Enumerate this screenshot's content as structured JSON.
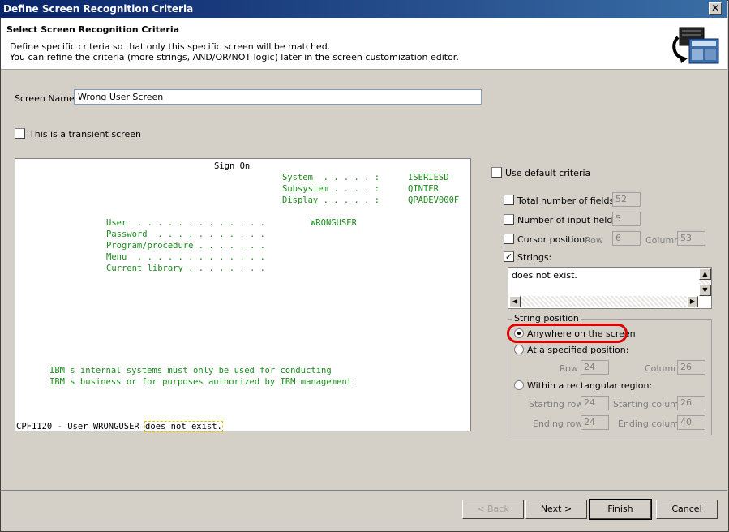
{
  "window": {
    "title": "Define Screen Recognition Criteria",
    "close": "✕"
  },
  "banner": {
    "title": "Select Screen Recognition Criteria",
    "line1": "Define specific criteria so that only this specific screen will be matched.",
    "line2": "You can refine the criteria (more strings, AND/OR/NOT logic) later in the screen customization editor."
  },
  "form": {
    "screen_name_label": "Screen Name:",
    "screen_name_value": "Wrong User Screen",
    "transient_label": "This is a transient screen"
  },
  "terminal": {
    "title": "Sign On",
    "system_label": "System  . . . . . :",
    "system_value": "ISERIESD",
    "subsystem_label": "Subsystem . . . . :",
    "subsystem_value": "QINTER",
    "display_label": "Display . . . . . :",
    "display_value": "QPADEV000F",
    "user_label": "User  . . . . . . . . . . . . .",
    "user_value": "WRONGUSER",
    "password_label": "Password  . . . . . . . . . . .",
    "program_label": "Program/procedure . . . . . . .",
    "menu_label": "Menu  . . . . . . . . . . . . .",
    "library_label": "Current library . . . . . . . .",
    "notice1": "IBM s internal systems must only be used for conducting",
    "notice2": "IBM s business or for purposes authorized by IBM management",
    "message_prefix": "CPF1120 - User WRONGUSER ",
    "message_highlight": "does not exist."
  },
  "criteria": {
    "use_default": "Use default criteria",
    "total_fields_label": "Total number of fields:",
    "total_fields_value": "52",
    "input_fields_label": "Number of input fields:",
    "input_fields_value": "5",
    "cursor_label": "Cursor position:",
    "row_label": "Row",
    "cursor_row": "6",
    "column_label": "Column",
    "cursor_col": "53",
    "strings_label": "Strings:",
    "strings_value": "does not exist.",
    "strings_checked": "✓"
  },
  "string_position": {
    "title": "String position",
    "anywhere": "Anywhere on the screen",
    "specified": "At a specified position:",
    "row_label": "Row",
    "row_value": "24",
    "column_label": "Column",
    "column_value": "26",
    "rectangular": "Within a rectangular region:",
    "start_row_label": "Starting row",
    "start_row_value": "24",
    "start_col_label": "Starting column",
    "start_col_value": "26",
    "end_row_label": "Ending row",
    "end_row_value": "24",
    "end_col_label": "Ending column",
    "end_col_value": "40"
  },
  "buttons": {
    "back": "< Back",
    "next": "Next >",
    "finish": "Finish",
    "cancel": "Cancel"
  },
  "colors": {
    "accent_oval": "#e00000",
    "terminal_green": "#1e8a1e"
  }
}
